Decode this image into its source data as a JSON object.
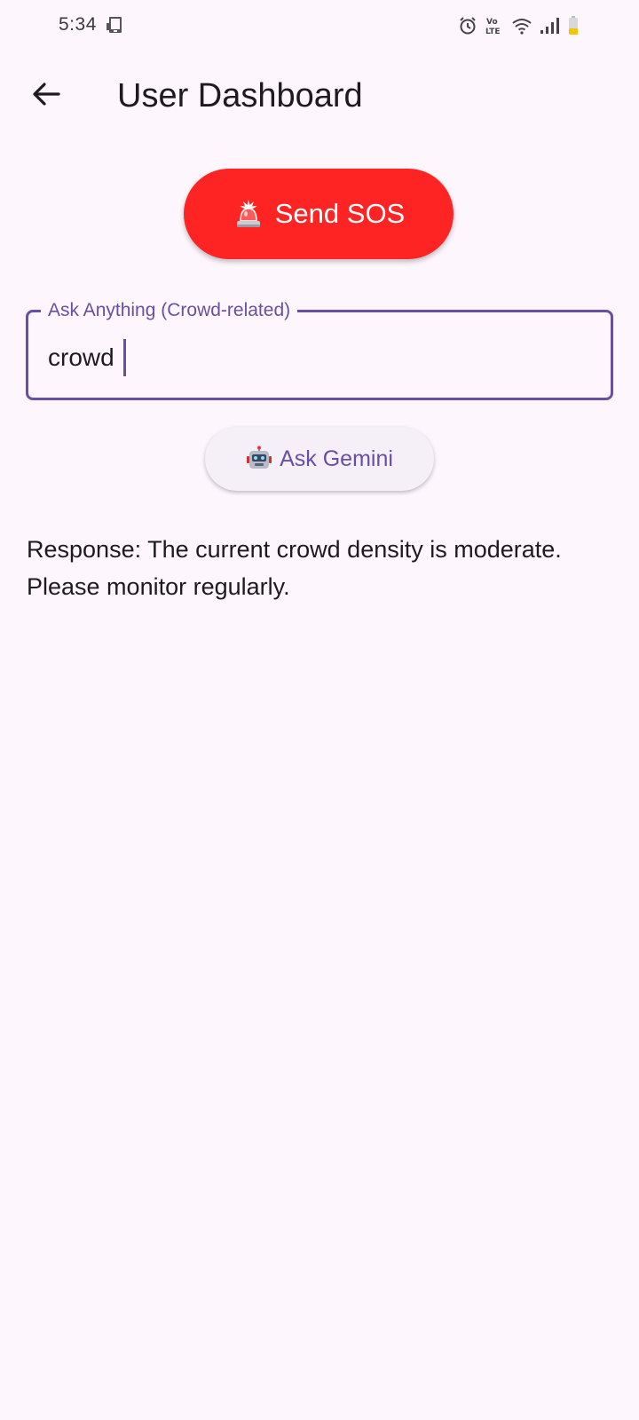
{
  "status_bar": {
    "time": "5:34",
    "left_icon": "tablet-notification-icon",
    "right_icons": [
      "alarm-icon",
      "volte-icon",
      "wifi-icon",
      "signal-icon",
      "battery-low-icon"
    ],
    "volte_label": "Vo LTE"
  },
  "app_bar": {
    "back_icon": "arrow-back-icon",
    "title": "User Dashboard"
  },
  "sos_button": {
    "icon": "rotating-light-icon",
    "label": "Send SOS",
    "color": "#ff2424"
  },
  "ask_field": {
    "label": "Ask Anything (Crowd-related)",
    "value": "crowd",
    "accent_color": "#6750a4"
  },
  "gemini_button": {
    "icon": "robot-icon",
    "label": "Ask Gemini"
  },
  "response": {
    "text": "Response: The current crowd density is moderate. Please monitor regularly."
  },
  "colors": {
    "background": "#fdf7fd",
    "primary": "#6750a4",
    "sos": "#ff2424"
  }
}
